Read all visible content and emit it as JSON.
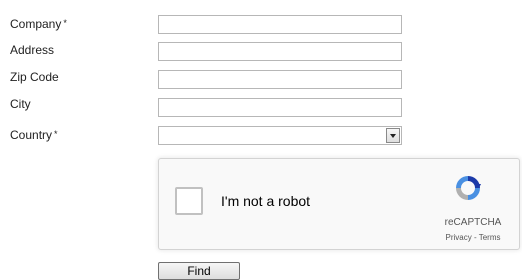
{
  "form": {
    "company": {
      "label": "Company",
      "required_mark": "*",
      "value": ""
    },
    "address": {
      "label": "Address",
      "value": ""
    },
    "zip": {
      "label": "Zip Code",
      "value": ""
    },
    "city": {
      "label": "City",
      "value": ""
    },
    "country": {
      "label": "Country",
      "required_mark": "*",
      "selected": ""
    }
  },
  "captcha": {
    "text": "I'm not a robot",
    "brand": "reCAPTCHA",
    "privacy": "Privacy",
    "separator": " - ",
    "terms": "Terms",
    "checked": false
  },
  "buttons": {
    "find_label": "Find"
  },
  "icons": {
    "dropdown": "chevron-down-icon",
    "captcha_logo": "recaptcha-logo-icon"
  },
  "colors": {
    "logo_blue_dark": "#1c3aa9",
    "logo_blue_light": "#4a90e2",
    "logo_gray": "#b0b0b0"
  }
}
